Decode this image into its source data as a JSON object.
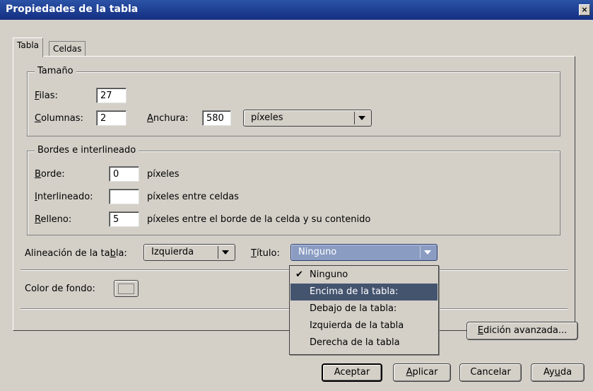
{
  "window": {
    "title": "Propiedades de la tabla",
    "close_glyph": "×"
  },
  "tabs": [
    {
      "label": "Tabla"
    },
    {
      "label": "Celdas"
    }
  ],
  "size_group": {
    "legend": "Tamaño",
    "rows": {
      "label_first": "F",
      "label_rest": "ilas:",
      "value": "27"
    },
    "columns": {
      "label_first": "C",
      "label_rest": "olumnas:",
      "value": "2"
    },
    "width": {
      "label_first": "A",
      "label_rest": "nchura:",
      "value": "580",
      "unit": "píxeles"
    }
  },
  "borders_group": {
    "legend": "Bordes e interlineado",
    "border": {
      "label_first": "B",
      "label_rest": "orde:",
      "value": "0",
      "suffix": "píxeles"
    },
    "spacing": {
      "label_first": "I",
      "label_rest": "nterlineado:",
      "value": "",
      "suffix": "píxeles entre celdas"
    },
    "padding": {
      "label_first": "R",
      "label_rest": "elleno:",
      "value": "5",
      "suffix": "píxeles entre el borde de la celda y su contenido"
    }
  },
  "alignment": {
    "label_a": "Alineación de la ta",
    "label_u": "b",
    "label_b": "la:",
    "value": "Izquierda"
  },
  "caption": {
    "label_first": "T",
    "label_rest": "ítulo:",
    "value": "Ninguno",
    "options": [
      "Ninguno",
      "Encima de la tabla:",
      "Debajo de la tabla:",
      "Izquierda de la tabla",
      "Derecha de la tabla"
    ],
    "checked_index": 0,
    "highlighted_index": 1
  },
  "background": {
    "label": "Color de fondo:",
    "color": "#d4d0c8"
  },
  "advanced_button": {
    "label_first": "E",
    "label_rest": "dición avanzada..."
  },
  "footer": {
    "ok": "Aceptar",
    "apply_first": "A",
    "apply_rest": "plicar",
    "cancel": "Cancelar",
    "help_a": "Ay",
    "help_u": "u",
    "help_b": "da"
  },
  "colors": {
    "titlebar": "#1f3f95",
    "dialog_bg": "#d4d0c8",
    "menu_highlight": "#44546f",
    "combo_active": "#8a9cc2"
  }
}
